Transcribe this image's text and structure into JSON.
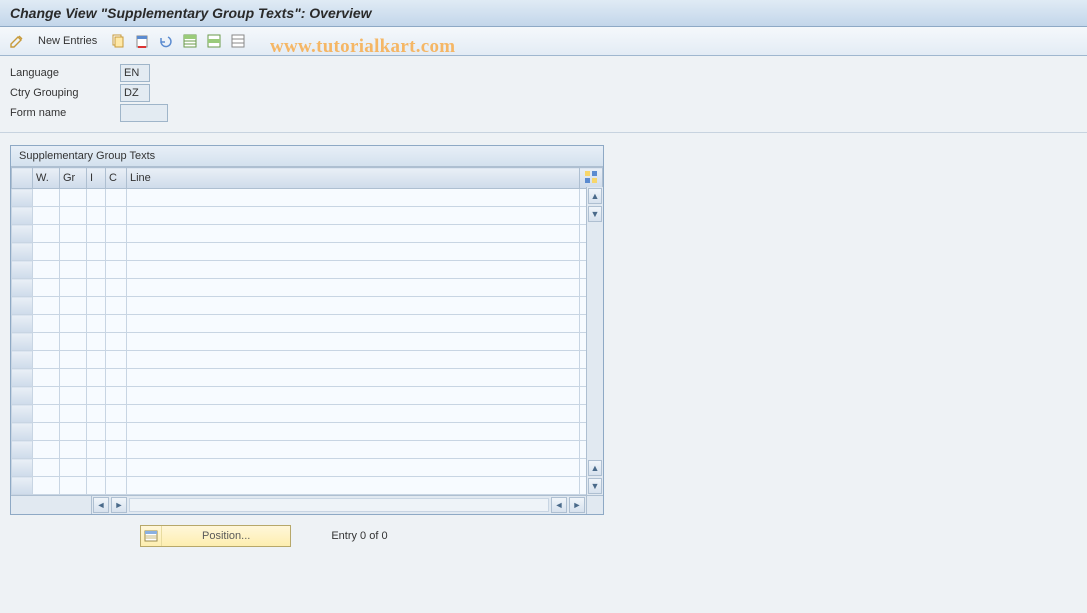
{
  "title": "Change View \"Supplementary Group Texts\": Overview",
  "watermark": "www.tutorialkart.com",
  "toolbar": {
    "new_entries": "New Entries"
  },
  "fields": {
    "language_label": "Language",
    "language_value": "EN",
    "ctry_label": "Ctry Grouping",
    "ctry_value": "DZ",
    "form_label": "Form name",
    "form_value": ""
  },
  "panel": {
    "title": "Supplementary Group Texts",
    "columns": {
      "w": "W.",
      "gr": "Gr",
      "i": "I",
      "c": "C",
      "line": "Line"
    },
    "rows": []
  },
  "footer": {
    "position_label": "Position...",
    "entry_text": "Entry 0 of 0"
  }
}
